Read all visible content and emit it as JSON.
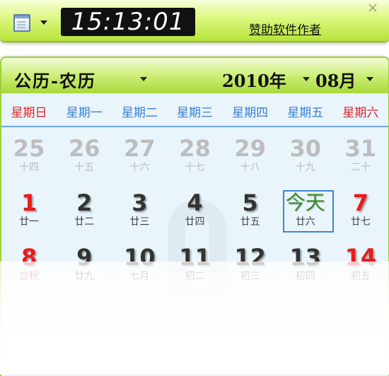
{
  "topbar": {
    "menu_icon": "document-icon",
    "clock_text": "15:13:01",
    "sponsor_link": "赞助软件作者"
  },
  "calendar": {
    "mode_label": "公历-农历",
    "year_label": "2010年",
    "month_label": "08月",
    "weekdays": [
      "星期日",
      "星期一",
      "星期二",
      "星期三",
      "星期四",
      "星期五",
      "星期六"
    ],
    "weeks": [
      [
        {
          "num": "25",
          "lunar": "十四",
          "other": true
        },
        {
          "num": "26",
          "lunar": "十五",
          "other": true
        },
        {
          "num": "27",
          "lunar": "十六",
          "other": true
        },
        {
          "num": "28",
          "lunar": "十七",
          "other": true
        },
        {
          "num": "29",
          "lunar": "十八",
          "other": true
        },
        {
          "num": "30",
          "lunar": "十九",
          "other": true
        },
        {
          "num": "31",
          "lunar": "二十",
          "other": true
        }
      ],
      [
        {
          "num": "1",
          "lunar": "廿一",
          "red": true
        },
        {
          "num": "2",
          "lunar": "廿二"
        },
        {
          "num": "3",
          "lunar": "廿三"
        },
        {
          "num": "4",
          "lunar": "廿四"
        },
        {
          "num": "5",
          "lunar": "廿五"
        },
        {
          "num": "今天",
          "lunar": "廿六",
          "today": true
        },
        {
          "num": "7",
          "lunar": "廿七",
          "red": true
        }
      ],
      [
        {
          "num": "8",
          "lunar": "立秋",
          "red": true,
          "term": true
        },
        {
          "num": "9",
          "lunar": "廿九"
        },
        {
          "num": "10",
          "lunar": "七月"
        },
        {
          "num": "11",
          "lunar": "初二"
        },
        {
          "num": "12",
          "lunar": "初三"
        },
        {
          "num": "13",
          "lunar": "初四"
        },
        {
          "num": "14",
          "lunar": "初五",
          "red": true
        }
      ]
    ]
  },
  "colors": {
    "accent_green": "#a8d93a",
    "weekday_blue": "#3b7fd1",
    "holiday_red": "#e81b1b",
    "today_border": "#3a86d6"
  }
}
